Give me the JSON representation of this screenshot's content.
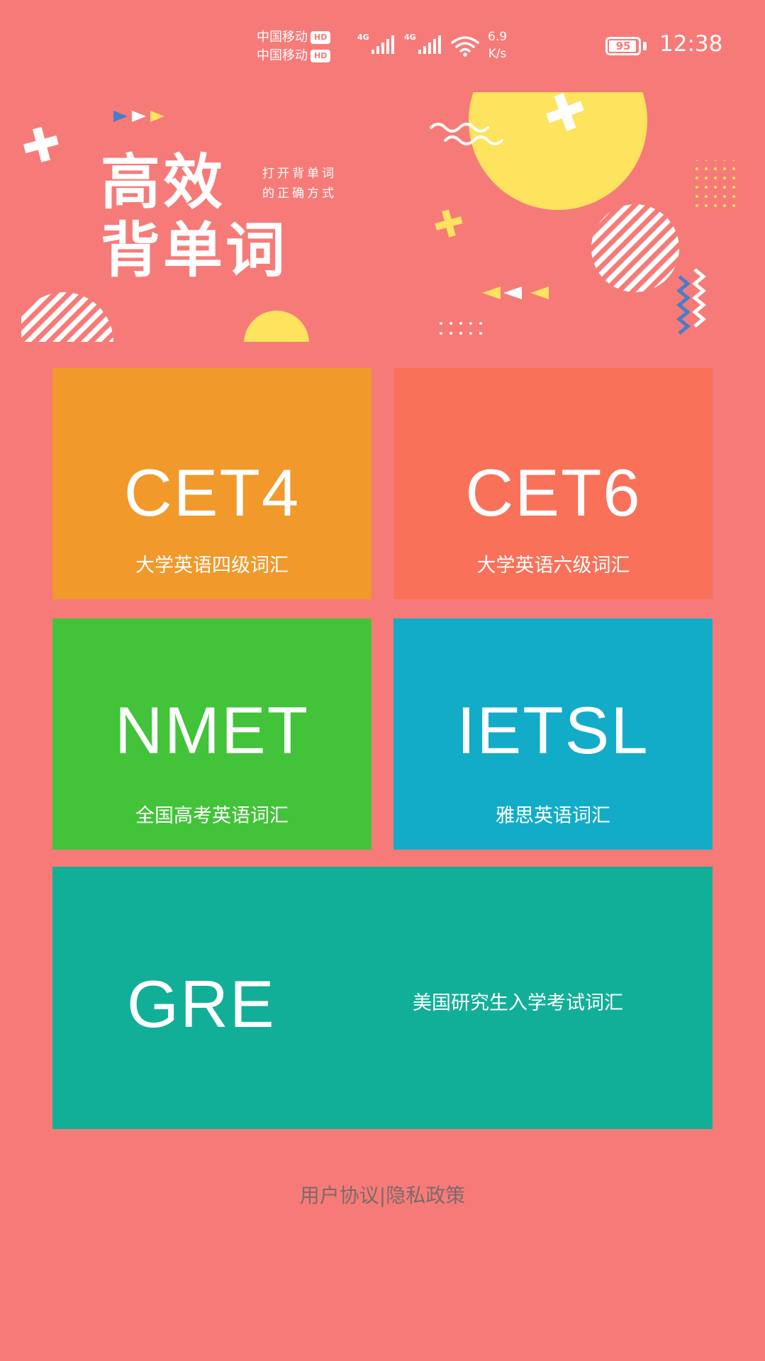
{
  "status_bar": {
    "carrier1": "中国移动",
    "carrier2": "中国移动",
    "hd": "HD",
    "network1": "4G",
    "network2": "4G",
    "speed_value": "6.9",
    "speed_unit": "K/s",
    "battery_level": 95,
    "battery_text": "95",
    "time": "12:38"
  },
  "banner": {
    "title_line1": "高效",
    "title_line2": "背单词",
    "subtitle_line1": "打开背单词",
    "subtitle_line2": "的正确方式",
    "colors": {
      "yellow": "#FDE35E",
      "white": "#FFFFFF",
      "blue": "#4A7CC9"
    }
  },
  "tiles": {
    "cet4": {
      "code": "CET4",
      "desc": "大学英语四级词汇",
      "color": "#F1992B"
    },
    "cet6": {
      "code": "CET6",
      "desc": "大学英语六级词汇",
      "color": "#F87158"
    },
    "nmet": {
      "code": "NMET",
      "desc": "全国高考英语词汇",
      "color": "#42C33A"
    },
    "ietsl": {
      "code": "IETSL",
      "desc": "雅思英语词汇",
      "color": "#12ACC8"
    },
    "gre": {
      "code": "GRE",
      "desc": "美国研究生入学考试词汇",
      "color": "#12AF98"
    }
  },
  "footer": {
    "agreement": "用户协议",
    "separator": "|",
    "privacy": "隐私政策"
  },
  "theme": {
    "background": "#F67B78",
    "footer_text": "#7C6A6A"
  }
}
